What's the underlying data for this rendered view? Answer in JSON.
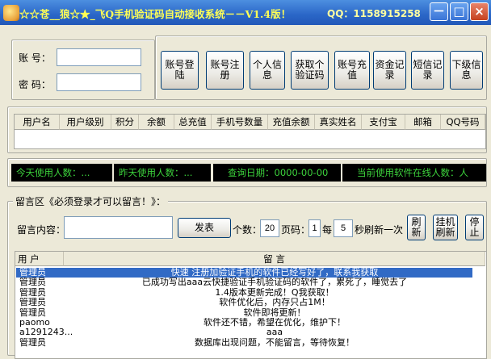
{
  "window": {
    "title": "☆☆苍__狼☆★_飞Q手机验证码自动接收系统－－V1.4版！",
    "qq": "QQ：1158915258",
    "minimize": "－",
    "restore": "□",
    "close": "×"
  },
  "login": {
    "account_label": "账  号：",
    "password_label": "密  码：",
    "account_value": "",
    "password_value": ""
  },
  "toolbar": {
    "buttons": [
      "账号登\n陆",
      "账号注\n册",
      "个人信\n息",
      "获取个\n验证码",
      "账号充\n值",
      "资金记\n录",
      "短信记\n录",
      "下级信\n息"
    ]
  },
  "user_table": {
    "headers": [
      "用户名",
      "用户级别",
      "积分",
      "余额",
      "总充值",
      "手机号数量",
      "充值余额",
      "真实姓名",
      "支付宝",
      "邮箱",
      "QQ号码"
    ]
  },
  "stats": {
    "today": "今天使用人数：...",
    "yesterday": "昨天使用人数：...",
    "query_date": "查询日期：0000-00-00",
    "online": "当前使用软件在线人数：人"
  },
  "message_board": {
    "legend": "留言区《必须登录才可以留言！》：",
    "content_label": "留言内容：",
    "content_value": "",
    "post_button": "发表",
    "count_label": "个数：",
    "count_value": "20",
    "page_label": "页码：",
    "page_value": "1",
    "every_label": "每",
    "every_value": "5",
    "refresh_suffix": "秒刷新一次",
    "refresh_button": "刷\n新",
    "auto_refresh_button": "挂机\n刷新",
    "stop_button": "停\n止",
    "col_user": "用 户",
    "col_message": "留 言",
    "rows": [
      {
        "user": "管理员",
        "message": "快速  注册加验证手机的软件已经写好了，联系我获取",
        "selected": true
      },
      {
        "user": "管理员",
        "message": "已成功写出aaa云快捷验证手机验证码的软件了，累死了，睡觉去了",
        "selected": false
      },
      {
        "user": "管理员",
        "message": "1.4版本更新完成！Q我获取！",
        "selected": false
      },
      {
        "user": "管理员",
        "message": "软件优化后，内存只占1M！",
        "selected": false
      },
      {
        "user": "管理员",
        "message": "软件即将更新！",
        "selected": false
      },
      {
        "user": "paomo",
        "message": "软件还不错，希望在优化，维护下！",
        "selected": false
      },
      {
        "user": "a1291243...",
        "message": "aaa",
        "selected": false
      },
      {
        "user": "管理员",
        "message": "数据库出现问题，不能留言，等待恢复！",
        "selected": false
      }
    ]
  }
}
